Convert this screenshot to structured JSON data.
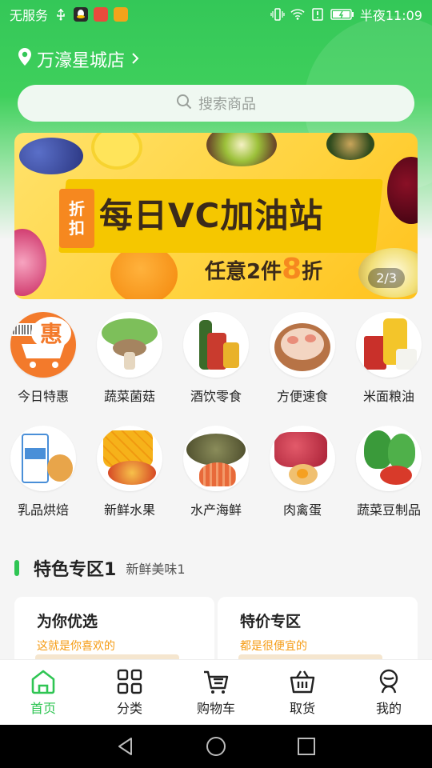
{
  "status_bar": {
    "carrier": "无服务",
    "time": "半夜11:09",
    "left_icons": [
      "usb-icon",
      "qq-icon",
      "app-icon",
      "app-icon"
    ],
    "right_icons": [
      "vibrate-icon",
      "wifi-icon",
      "alert-icon",
      "battery-icon"
    ]
  },
  "store": {
    "name": "万濠星城店",
    "icon": "location-pin-icon"
  },
  "search": {
    "placeholder": "搜索商品",
    "icon": "search-icon"
  },
  "banner": {
    "tag_line1": "折",
    "tag_line2": "扣",
    "title": "每日VC加油站",
    "subtitle_prefix": "任意2件",
    "subtitle_number": "8",
    "subtitle_suffix": "折",
    "pager": "2/3"
  },
  "categories": [
    {
      "label": "今日特惠",
      "icon": "hui-icon",
      "color": "#f37a2b"
    },
    {
      "label": "蔬菜菌菇",
      "icon": "mushroom-icon",
      "color": "#7dbf5a"
    },
    {
      "label": "酒饮零食",
      "icon": "drink-icon",
      "color": "#c93b2e"
    },
    {
      "label": "方便速食",
      "icon": "dumpling-icon",
      "color": "#e9b28d"
    },
    {
      "label": "米面粮油",
      "icon": "rice-oil-icon",
      "color": "#e8b32b"
    },
    {
      "label": "乳品烘焙",
      "icon": "milk-icon",
      "color": "#4a8fd8"
    },
    {
      "label": "新鲜水果",
      "icon": "mango-icon",
      "color": "#f6b21a"
    },
    {
      "label": "水产海鲜",
      "icon": "fish-icon",
      "color": "#7a7b4a"
    },
    {
      "label": "肉禽蛋",
      "icon": "meat-icon",
      "color": "#c33b4a"
    },
    {
      "label": "蔬菜豆制品",
      "icon": "vegetable-icon",
      "color": "#3a9a3a"
    }
  ],
  "section": {
    "title": "特色专区1",
    "subtitle": "新鲜美味1",
    "accent": "#2fc553",
    "cards": [
      {
        "title": "为你优选",
        "subtitle": "这就是你喜欢的"
      },
      {
        "title": "特价专区",
        "subtitle": "都是很便宜的"
      }
    ]
  },
  "tabbar": {
    "active_color": "#2fc553",
    "tabs": [
      {
        "label": "首页",
        "icon": "home-icon",
        "active": true
      },
      {
        "label": "分类",
        "icon": "grid-icon",
        "active": false
      },
      {
        "label": "购物车",
        "icon": "cart-icon",
        "active": false
      },
      {
        "label": "取货",
        "icon": "basket-icon",
        "active": false
      },
      {
        "label": "我的",
        "icon": "profile-icon",
        "active": false
      }
    ]
  },
  "nav": {
    "icons": [
      "back-icon",
      "home-circle-icon",
      "recents-icon"
    ]
  }
}
